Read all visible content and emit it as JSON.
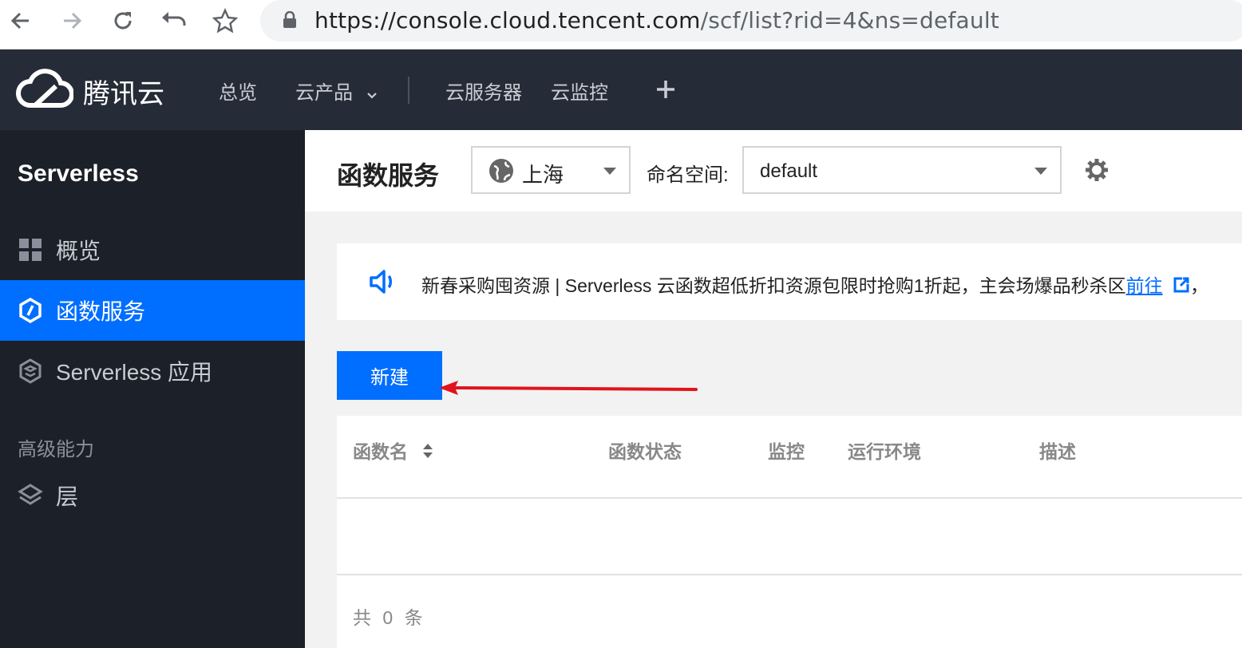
{
  "browser": {
    "url_host": "https://console.cloud.tencent.com",
    "url_path": "/scf/list?rid=4&ns=default"
  },
  "topnav": {
    "brand": "腾讯云",
    "items": [
      "总览",
      "云产品",
      "云服务器",
      "云监控"
    ],
    "add_label": "+"
  },
  "sidebar": {
    "title": "Serverless",
    "items": [
      {
        "label": "概览",
        "icon": "grid-icon"
      },
      {
        "label": "函数服务",
        "icon": "function-icon",
        "active": true
      },
      {
        "label": "Serverless 应用",
        "icon": "app-icon"
      }
    ],
    "group_label": "高级能力",
    "group_items": [
      {
        "label": "层",
        "icon": "layers-icon"
      }
    ]
  },
  "header": {
    "title": "函数服务",
    "region": "上海",
    "namespace_label": "命名空间:",
    "namespace_value": "default"
  },
  "notice": {
    "text": "新春采购囤资源 | Serverless 云函数超低折扣资源包限时抢购1折起，主会场爆品秒杀区",
    "link": "前往",
    "tail": "，"
  },
  "actions": {
    "new_label": "新建"
  },
  "table": {
    "columns": [
      "函数名",
      "函数状态",
      "监控",
      "运行环境",
      "描述"
    ],
    "total_text": "共 0 条"
  },
  "colors": {
    "accent": "#006eff",
    "topnav_bg": "#262c37",
    "sidebar_bg": "#1c2029",
    "annotation_arrow": "#e0141c"
  }
}
